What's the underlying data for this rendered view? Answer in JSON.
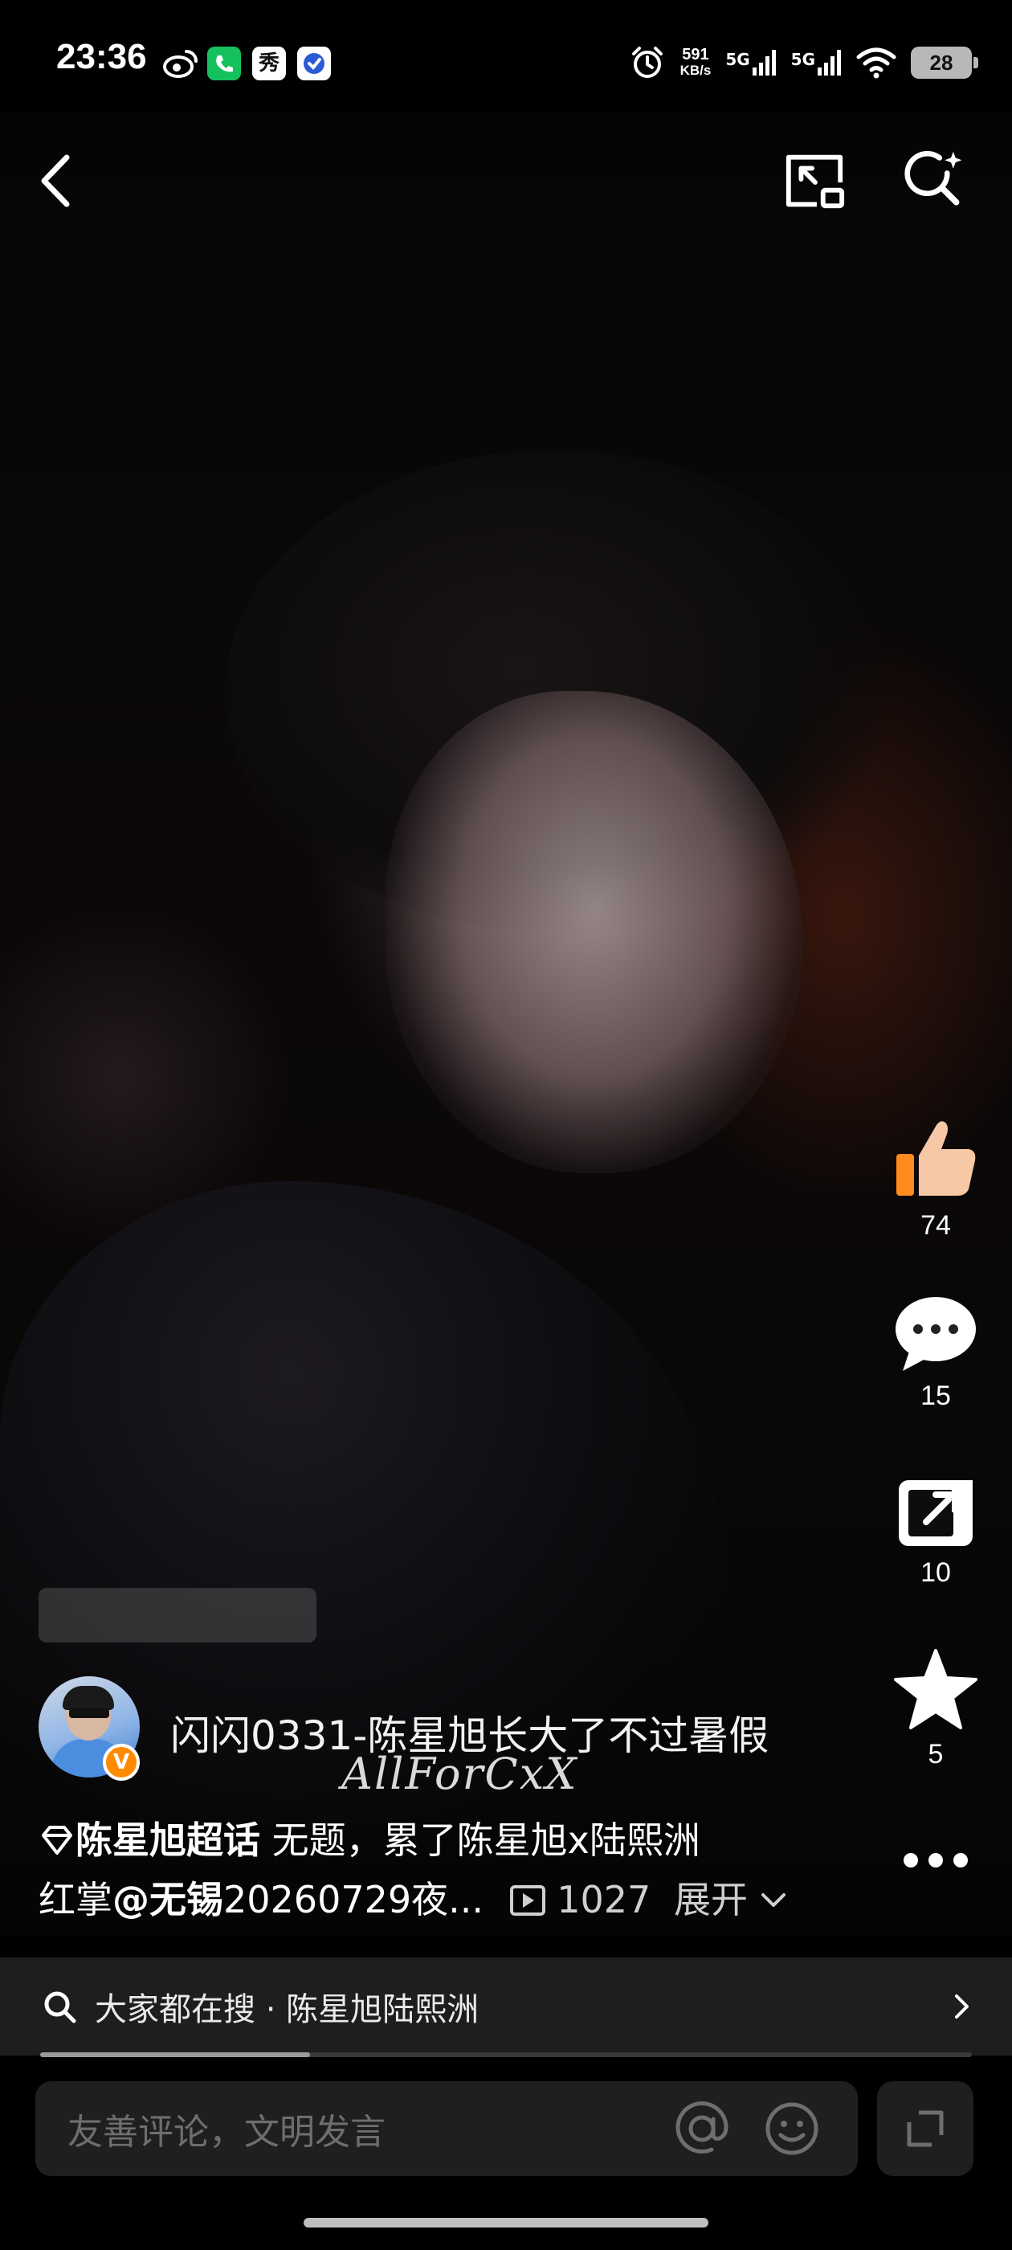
{
  "status_bar": {
    "time": "23:36",
    "apps": [
      "weibo-icon",
      "call-app-icon",
      "xiu-app-icon",
      "check-app-icon"
    ],
    "xiu_label": "秀",
    "net_speed_value": "591",
    "net_speed_unit": "KB/s",
    "sim1": "5G",
    "sim2": "5G",
    "battery": "28"
  },
  "actions": {
    "like_count": "74",
    "comment_count": "15",
    "share_count": "10",
    "favorite_count": "5"
  },
  "post": {
    "title": "闪闪0331-陈星旭长大了不过暑假",
    "watermark": "AllForCxX",
    "verified_badge": "V",
    "topic": "陈星旭超话",
    "line1_text": " 无题，累了陈星旭x陆熙洲",
    "line2_prefix": "红掌",
    "mention": "@无锡",
    "line2_text": "20260729夜...",
    "views": "1027",
    "expand": "展开"
  },
  "search": {
    "text": "大家都在搜 · 陈星旭陆熙洲",
    "progress": 0.29
  },
  "comment": {
    "placeholder": "友善评论，文明发言"
  },
  "colors": {
    "like_accent": "#ff8a1e",
    "verified_badge": "#ff8a00"
  }
}
